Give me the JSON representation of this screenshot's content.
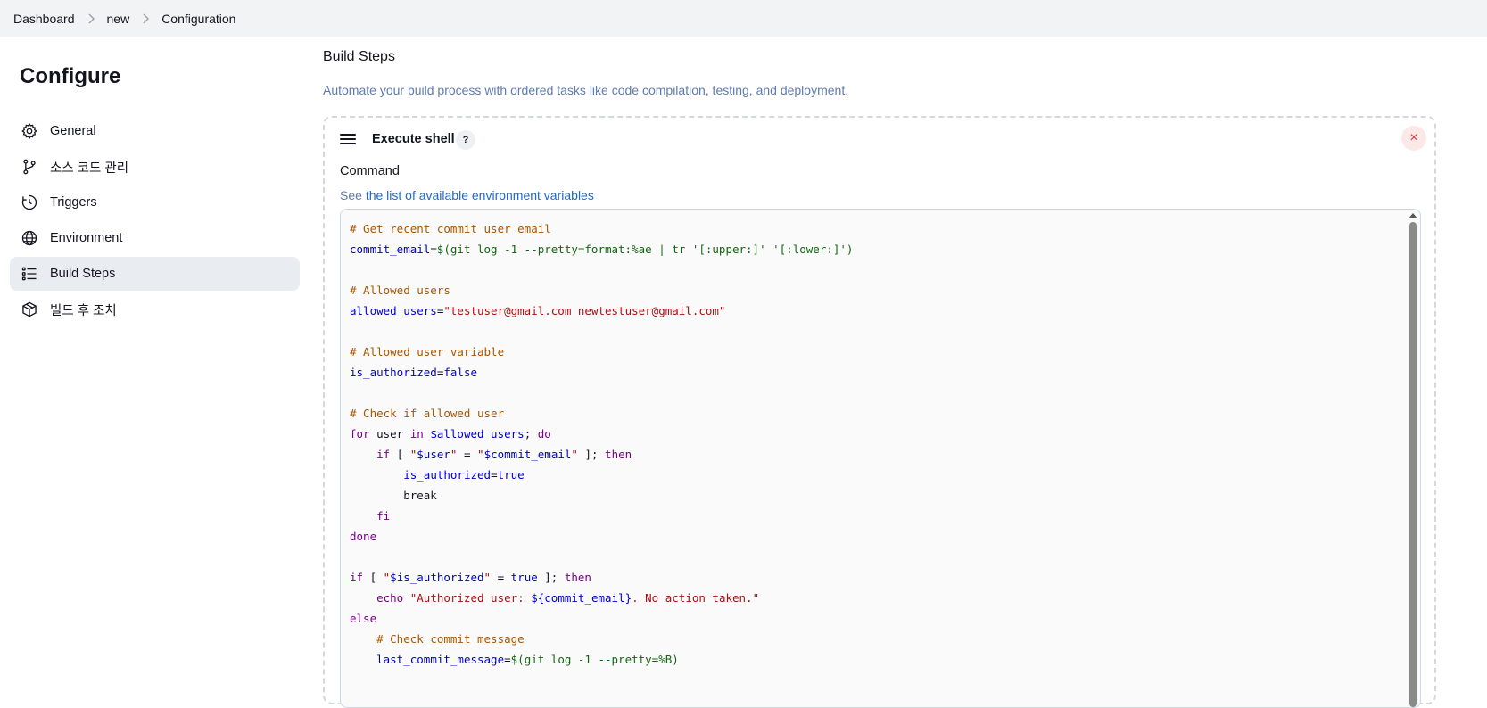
{
  "breadcrumb": {
    "items": [
      "Dashboard",
      "new",
      "Configuration"
    ]
  },
  "sidebar": {
    "title": "Configure",
    "items": [
      {
        "label": "General",
        "icon": "gear-icon",
        "active": false
      },
      {
        "label": "소스 코드 관리",
        "icon": "branch-icon",
        "active": false
      },
      {
        "label": "Triggers",
        "icon": "clock-icon",
        "active": false
      },
      {
        "label": "Environment",
        "icon": "globe-icon",
        "active": false
      },
      {
        "label": "Build Steps",
        "icon": "list-icon",
        "active": true
      },
      {
        "label": "빌드 후 조치",
        "icon": "package-icon",
        "active": false
      }
    ]
  },
  "main": {
    "section_title": "Build Steps",
    "section_desc": "Automate your build process with ordered tasks like code compilation, testing, and deployment.",
    "step": {
      "title": "Execute shell",
      "help_label": "?",
      "close_label": "×",
      "command_label": "Command",
      "hint_prefix": "See ",
      "hint_link": "the list of available environment variables"
    },
    "code_lines": [
      [
        {
          "t": "# Get recent commit user email",
          "c": "comment"
        }
      ],
      [
        {
          "t": "commit_email",
          "c": "var"
        },
        {
          "t": "=",
          "c": "op"
        },
        {
          "t": "$(git log -1 --pretty=format:%ae | tr '[:upper:]' '[:lower:]')",
          "c": "sub"
        }
      ],
      [],
      [
        {
          "t": "# Allowed users",
          "c": "comment"
        }
      ],
      [
        {
          "t": "allowed_users",
          "c": "var"
        },
        {
          "t": "=",
          "c": "op"
        },
        {
          "t": "\"testuser@gmail.com newtestuser@gmail.com\"",
          "c": "str"
        }
      ],
      [],
      [
        {
          "t": "# Allowed user variable",
          "c": "comment"
        }
      ],
      [
        {
          "t": "is_authorized",
          "c": "var"
        },
        {
          "t": "=",
          "c": "op"
        },
        {
          "t": "false",
          "c": "bool"
        }
      ],
      [],
      [
        {
          "t": "# Check if allowed user",
          "c": "comment"
        }
      ],
      [
        {
          "t": "for",
          "c": "kw"
        },
        {
          "t": " user ",
          "c": "op"
        },
        {
          "t": "in",
          "c": "kw"
        },
        {
          "t": " ",
          "c": "op"
        },
        {
          "t": "$allowed_users",
          "c": "var"
        },
        {
          "t": "; ",
          "c": "op"
        },
        {
          "t": "do",
          "c": "kw"
        }
      ],
      [
        {
          "t": "    ",
          "c": "op"
        },
        {
          "t": "if",
          "c": "kw"
        },
        {
          "t": " [ ",
          "c": "op"
        },
        {
          "t": "\"",
          "c": "str"
        },
        {
          "t": "$user",
          "c": "var"
        },
        {
          "t": "\"",
          "c": "str"
        },
        {
          "t": " = ",
          "c": "op"
        },
        {
          "t": "\"",
          "c": "str"
        },
        {
          "t": "$commit_email",
          "c": "var"
        },
        {
          "t": "\"",
          "c": "str"
        },
        {
          "t": " ]; ",
          "c": "op"
        },
        {
          "t": "then",
          "c": "kw"
        }
      ],
      [
        {
          "t": "        ",
          "c": "op"
        },
        {
          "t": "is_authorized",
          "c": "var"
        },
        {
          "t": "=",
          "c": "op"
        },
        {
          "t": "true",
          "c": "bool"
        }
      ],
      [
        {
          "t": "        break",
          "c": "op"
        }
      ],
      [
        {
          "t": "    ",
          "c": "op"
        },
        {
          "t": "fi",
          "c": "kw"
        }
      ],
      [
        {
          "t": "done",
          "c": "kw"
        }
      ],
      [],
      [
        {
          "t": "if",
          "c": "kw"
        },
        {
          "t": " [ ",
          "c": "op"
        },
        {
          "t": "\"",
          "c": "str"
        },
        {
          "t": "$is_authorized",
          "c": "var"
        },
        {
          "t": "\"",
          "c": "str"
        },
        {
          "t": " = ",
          "c": "op"
        },
        {
          "t": "true",
          "c": "bool"
        },
        {
          "t": " ]; ",
          "c": "op"
        },
        {
          "t": "then",
          "c": "kw"
        }
      ],
      [
        {
          "t": "    ",
          "c": "op"
        },
        {
          "t": "echo",
          "c": "kw"
        },
        {
          "t": " ",
          "c": "op"
        },
        {
          "t": "\"Authorized user: ",
          "c": "str"
        },
        {
          "t": "${commit_email}",
          "c": "var"
        },
        {
          "t": ". No action taken.\"",
          "c": "str"
        }
      ],
      [
        {
          "t": "else",
          "c": "kw"
        }
      ],
      [
        {
          "t": "    ",
          "c": "op"
        },
        {
          "t": "# Check commit message",
          "c": "comment"
        }
      ],
      [
        {
          "t": "    ",
          "c": "op"
        },
        {
          "t": "last_commit_message",
          "c": "var"
        },
        {
          "t": "=",
          "c": "op"
        },
        {
          "t": "$(git log -1 --pretty=%B)",
          "c": "sub"
        }
      ]
    ]
  }
}
